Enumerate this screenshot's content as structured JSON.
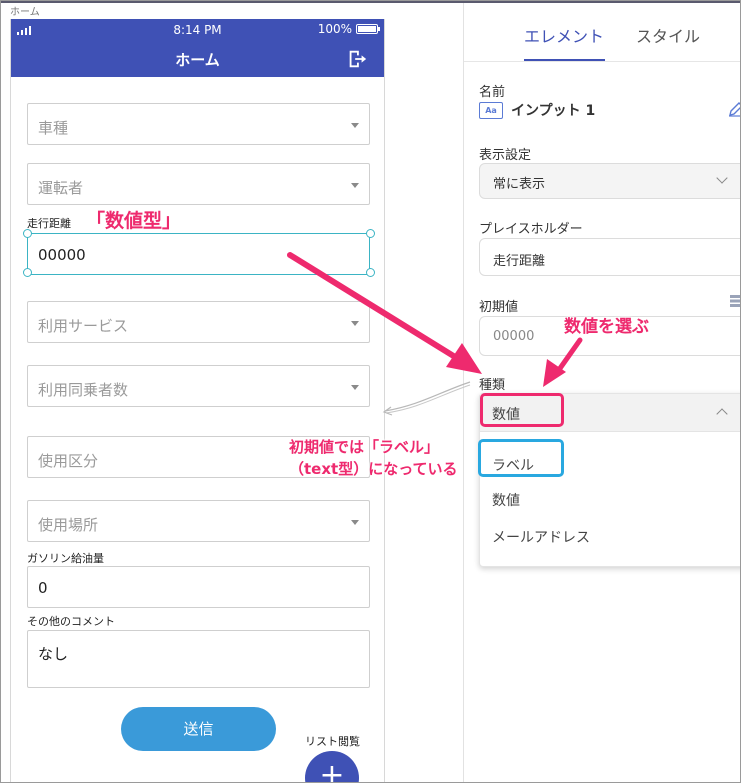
{
  "canvas": {
    "label": "ホーム"
  },
  "statusbar": {
    "time": "8:14 PM",
    "battery": "100%"
  },
  "appbar": {
    "title": "ホーム"
  },
  "form": {
    "car_type": "車種",
    "driver": "運転者",
    "distance_label": "走行距離",
    "distance_value": "00000",
    "service": "利用サービス",
    "passengers": "利用同乗者数",
    "usage_type": "使用区分",
    "usage_place": "使用場所",
    "fuel_label": "ガソリン給油量",
    "fuel_value": "0",
    "comment_label": "その他のコメント",
    "comment_value": "なし",
    "submit_label": "送信",
    "list_label": "リスト閲覧",
    "fab_label": "+"
  },
  "panel": {
    "tab_element": "エレメント",
    "tab_style": "スタイル",
    "name_label": "名前",
    "name_icon_text": "Aa",
    "name_value": "インプット 1",
    "visibility_label": "表示設定",
    "visibility_value": "常に表示",
    "placeholder_label": "プレイスホルダー",
    "placeholder_value": "走行距離",
    "initial_label": "初期値",
    "initial_value": "00000",
    "type_label": "種類",
    "type_selected": "数値",
    "options": [
      "ラベル",
      "数値",
      "メールアドレス"
    ]
  },
  "annotations": {
    "numeric_type": "「数値型」",
    "choose_numeric": "数値を選ぶ",
    "default_label_line1": "初期値では「ラベル」",
    "default_label_line2": "（text型）になっている"
  },
  "colors": {
    "header": "#3f51b5",
    "submit": "#3a9ad9",
    "annotation": "#ee2a6e",
    "highlight_blue": "#29a8e0",
    "selection": "#3bb4c4"
  }
}
